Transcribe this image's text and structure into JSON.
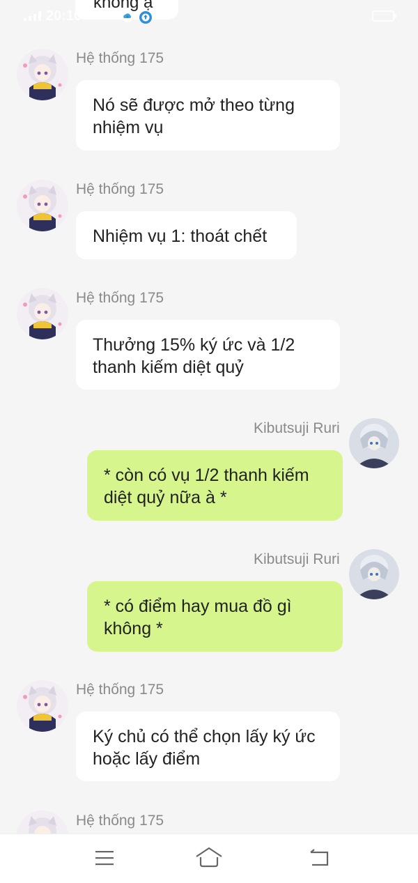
{
  "status_bar": {
    "time": "20:10",
    "icons": [
      "signal-icon",
      "cloud-upload-icon",
      "upload-app-icon",
      "battery-icon"
    ]
  },
  "partial_top_message": {
    "text": "không ạ"
  },
  "messages": [
    {
      "sender": "Hệ thống 175",
      "side": "left",
      "text": "Nó sẽ được mở theo từng nhiệm vụ"
    },
    {
      "sender": "Hệ thống 175",
      "side": "left",
      "text": "Nhiệm vụ 1: thoát chết"
    },
    {
      "sender": "Hệ thống 175",
      "side": "left",
      "text": "Thưởng 15% ký ức và 1/2 thanh kiếm diệt quỷ"
    },
    {
      "sender": "Kibutsuji Ruri",
      "side": "right",
      "text": "* còn có vụ 1/2 thanh kiếm diệt quỷ nữa à *"
    },
    {
      "sender": "Kibutsuji Ruri",
      "side": "right",
      "text": "* có điểm hay mua đồ gì không *"
    },
    {
      "sender": "Hệ thống 175",
      "side": "left",
      "text": "Ký chủ có thể chọn lấy ký ức hoặc lấy điểm"
    }
  ],
  "partial_bottom_message": {
    "sender": "Hệ thống 175"
  },
  "nav_bar": {
    "buttons": [
      "menu-icon",
      "home-icon",
      "back-icon"
    ]
  },
  "colors": {
    "background": "#f5f5f5",
    "left_bubble": "#ffffff",
    "right_bubble": "#d6f58d",
    "sender_text": "#8a8a8a"
  }
}
